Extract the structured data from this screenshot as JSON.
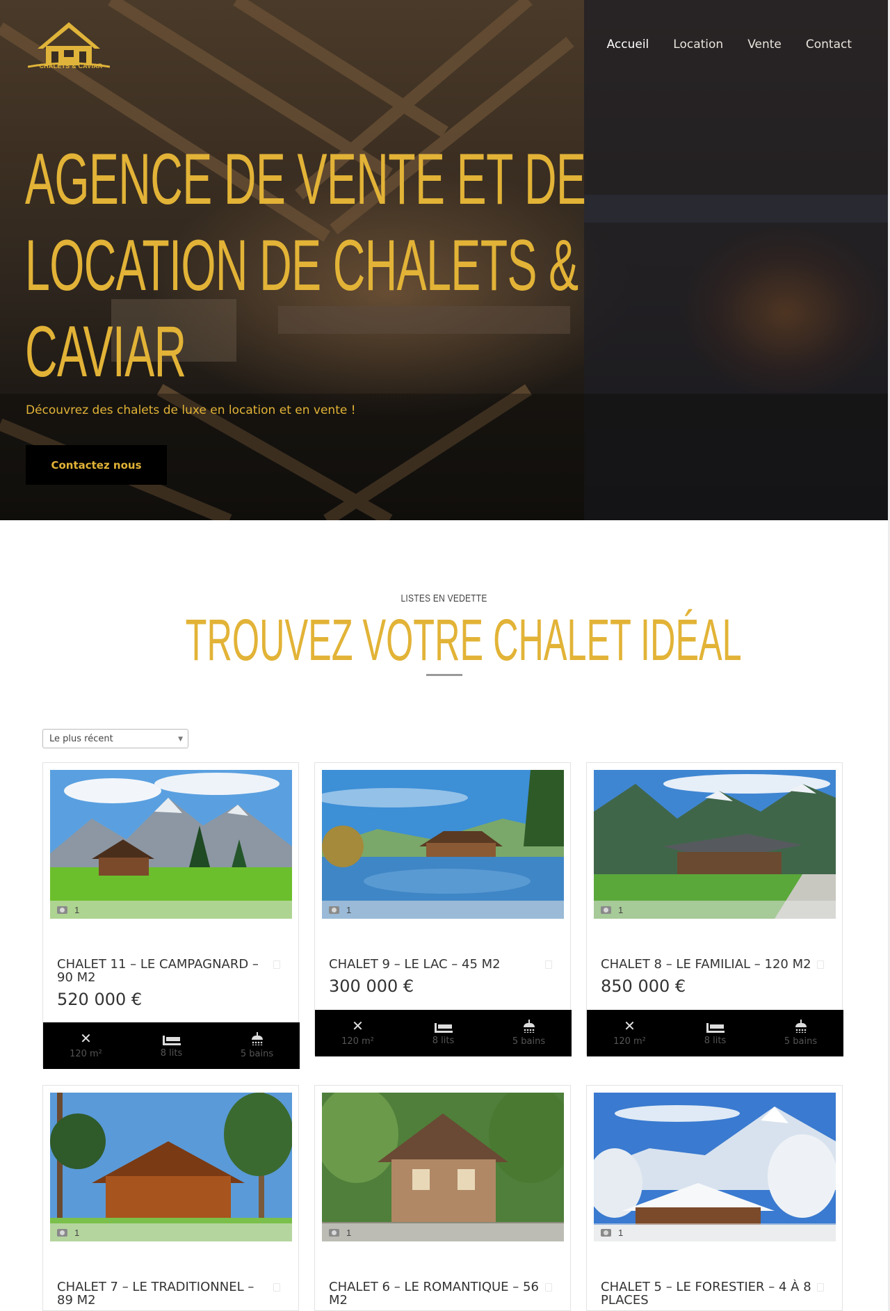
{
  "brand": {
    "logo_text": "CHALETS & CAVIAR"
  },
  "nav": {
    "items": [
      "Accueil",
      "Location",
      "Vente",
      "Contact"
    ],
    "active": "Accueil"
  },
  "hero": {
    "title_lines": [
      "AGENCE DE VENTE ET DE",
      "LOCATION DE CHALETS &",
      "CAVIAR"
    ],
    "subtitle": "Découvrez des chalets de luxe en location et en vente !",
    "cta_label": "Contactez nous"
  },
  "listings_section": {
    "kicker": "LISTES EN VEDETTE",
    "title": "TROUVEZ VOTRE CHALET IDÉAL",
    "sort_selected": "Le plus récent"
  },
  "cards": [
    {
      "title": "CHALET 11 – LE CAMPAGNARD – 90 M2",
      "price": "520 000 €",
      "photo_count": "1",
      "area": "120 m²",
      "beds": "8 lits",
      "baths": "5 bains"
    },
    {
      "title": "CHALET 9 – LE LAC – 45 M2",
      "price": "300 000 €",
      "photo_count": "1",
      "area": "120 m²",
      "beds": "8 lits",
      "baths": "5 bains"
    },
    {
      "title": "CHALET 8 – LE FAMILIAL – 120 M2",
      "price": "850 000 €",
      "photo_count": "1",
      "area": "120 m²",
      "beds": "8 lits",
      "baths": "5 bains"
    },
    {
      "title": "CHALET 7 – LE TRADITIONNEL – 89 M2",
      "photo_count": "1"
    },
    {
      "title": "CHALET 6 – LE ROMANTIQUE – 56 M2",
      "photo_count": "1"
    },
    {
      "title": "CHALET 5 – LE FORESTIER – 4 À 8 PLACES",
      "photo_count": "1"
    }
  ],
  "colors": {
    "accent": "#e2b337",
    "dark": "#000000"
  }
}
